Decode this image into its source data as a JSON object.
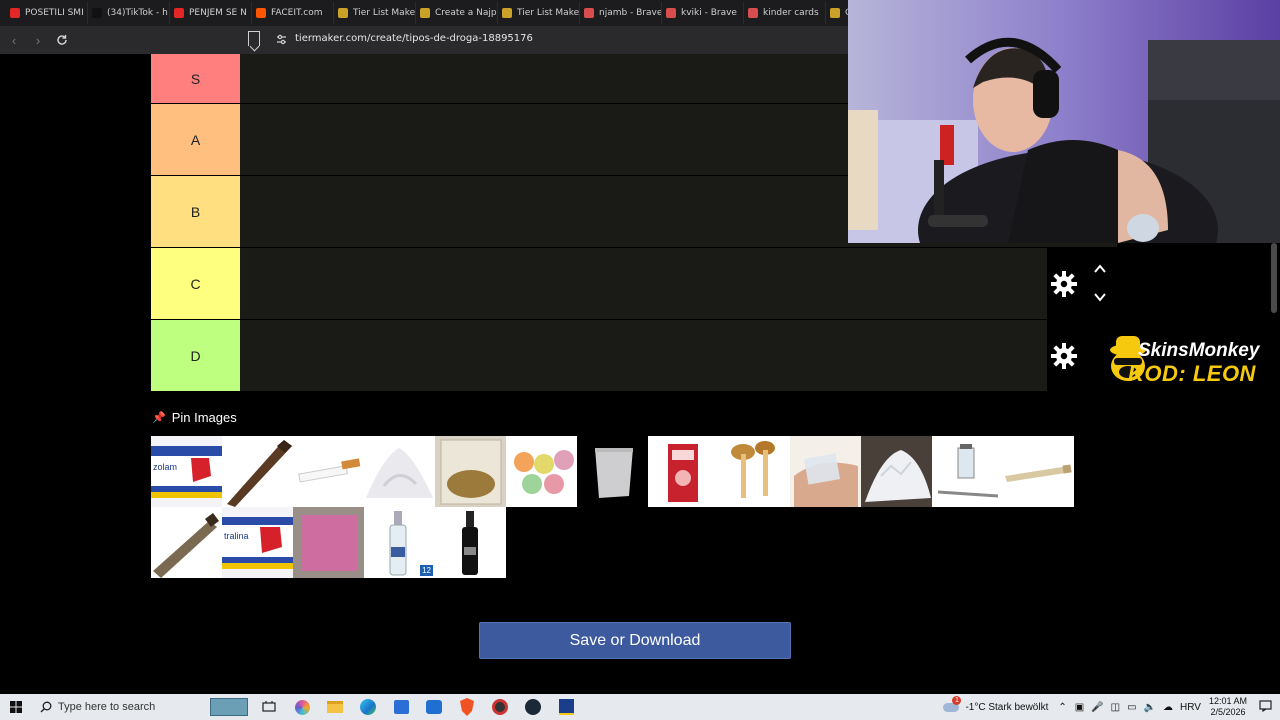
{
  "browser": {
    "tabs": [
      {
        "title": "POSETILI SMI",
        "color": "#e32626"
      },
      {
        "title": "(34)TikTok - h",
        "color": "#111111"
      },
      {
        "title": "PENJEM SE N",
        "color": "#e32626"
      },
      {
        "title": "FACEIT.com",
        "color": "#ff5500"
      },
      {
        "title": "Tier List Make",
        "color": "#c9a227"
      },
      {
        "title": "Create a Najp",
        "color": "#c9a227"
      },
      {
        "title": "Tier List Make",
        "color": "#c9a227"
      },
      {
        "title": "njamb - Brave",
        "color": "#d84d4d"
      },
      {
        "title": "kviki - Brave",
        "color": "#d84d4d"
      },
      {
        "title": "kinder cards",
        "color": "#d84d4d"
      },
      {
        "title": "Cr",
        "color": "#c9a227"
      }
    ],
    "url": "tiermaker.com/create/tipos-de-droga-18895176"
  },
  "tiers": [
    {
      "label": "S",
      "color": "#ff7f7f"
    },
    {
      "label": "A",
      "color": "#ffbf7f"
    },
    {
      "label": "B",
      "color": "#ffdf7f"
    },
    {
      "label": "C",
      "color": "#ffff7f"
    },
    {
      "label": "D",
      "color": "#bfff7f"
    }
  ],
  "pin_images_label": "Pin Images",
  "pool_images": [
    {
      "name": "clonazepam-box"
    },
    {
      "name": "cigar"
    },
    {
      "name": "cigarette"
    },
    {
      "name": "white-powder-pile"
    },
    {
      "name": "tobacco-bag"
    },
    {
      "name": "ecstasy-pills"
    },
    {
      "name": "powder-baggie"
    },
    {
      "name": "red-pack"
    },
    {
      "name": "mushrooms"
    },
    {
      "name": "hand-baggie"
    },
    {
      "name": "crystal-pile"
    },
    {
      "name": "syringe-vial"
    },
    {
      "name": "joint"
    },
    {
      "name": "joint-dark"
    },
    {
      "name": "sertraline-box"
    },
    {
      "name": "pink-powder"
    },
    {
      "name": "vodka-clear"
    },
    {
      "name": "vodka-black"
    }
  ],
  "vodka_badge": "12",
  "save_label": "Save or Download",
  "sponsor": {
    "name": "SkinsMonkey",
    "code": "KOD: LEON"
  },
  "taskbar": {
    "search_placeholder": "Type here to search",
    "weather": "-1°C  Stark bewölkt",
    "language": "HRV",
    "time": "12:01 AM",
    "date": "2/5/2026",
    "weather_badge": "1"
  }
}
